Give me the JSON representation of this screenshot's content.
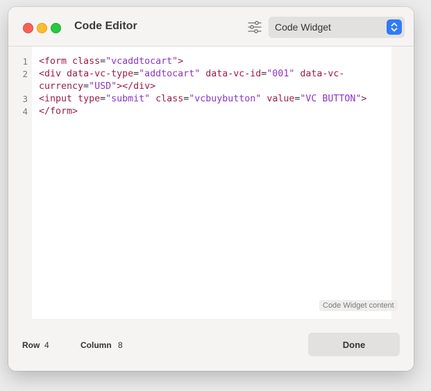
{
  "window": {
    "title": "Code Editor"
  },
  "toolbar": {
    "settings_icon": "sliders-icon",
    "widget_select": "Code Widget"
  },
  "editor": {
    "line_numbers": [
      "1",
      "2",
      "",
      "3",
      "4"
    ],
    "lines": [
      {
        "tokens": [
          {
            "t": "tag",
            "v": "<form"
          },
          {
            "t": "sp",
            "v": " "
          },
          {
            "t": "attr",
            "v": "class"
          },
          {
            "t": "eq",
            "v": "="
          },
          {
            "t": "val",
            "v": "\"vcaddtocart\""
          },
          {
            "t": "punc",
            "v": ">"
          }
        ]
      },
      {
        "tokens": [
          {
            "t": "tag",
            "v": "<div"
          },
          {
            "t": "sp",
            "v": " "
          },
          {
            "t": "attr",
            "v": "data-vc-type"
          },
          {
            "t": "eq",
            "v": "="
          },
          {
            "t": "val",
            "v": "\"addtocart\""
          },
          {
            "t": "sp",
            "v": " "
          },
          {
            "t": "attr",
            "v": "data-vc-id"
          },
          {
            "t": "eq",
            "v": "="
          },
          {
            "t": "val",
            "v": "\"001\""
          },
          {
            "t": "sp",
            "v": " "
          },
          {
            "t": "attr",
            "v": "data-vc-"
          }
        ]
      },
      {
        "tokens": [
          {
            "t": "attr",
            "v": "currency"
          },
          {
            "t": "eq",
            "v": "="
          },
          {
            "t": "val",
            "v": "\"USD\""
          },
          {
            "t": "punc",
            "v": "></div>"
          }
        ]
      },
      {
        "tokens": [
          {
            "t": "tag",
            "v": "<input"
          },
          {
            "t": "sp",
            "v": " "
          },
          {
            "t": "attr",
            "v": "type"
          },
          {
            "t": "eq",
            "v": "="
          },
          {
            "t": "val",
            "v": "\"submit\""
          },
          {
            "t": "sp",
            "v": " "
          },
          {
            "t": "attr",
            "v": "class"
          },
          {
            "t": "eq",
            "v": "="
          },
          {
            "t": "val",
            "v": "\"vcbuybutton\""
          },
          {
            "t": "sp",
            "v": " "
          },
          {
            "t": "attr",
            "v": "value"
          },
          {
            "t": "eq",
            "v": "="
          },
          {
            "t": "val",
            "v": "\"VC BUTTON\""
          },
          {
            "t": "punc",
            "v": ">"
          }
        ]
      },
      {
        "tokens": [
          {
            "t": "tag",
            "v": "</form>"
          }
        ]
      }
    ],
    "content_tag": "Code Widget content"
  },
  "footer": {
    "row_label": "Row",
    "row_value": "4",
    "column_label": "Column",
    "column_value": "8",
    "done_label": "Done"
  },
  "colors": {
    "tag": "#9b1d4a",
    "value": "#8a36c8",
    "accent": "#2f7cf6",
    "close": "#ff5f57",
    "minimize": "#febc2e",
    "zoom": "#28c840"
  }
}
